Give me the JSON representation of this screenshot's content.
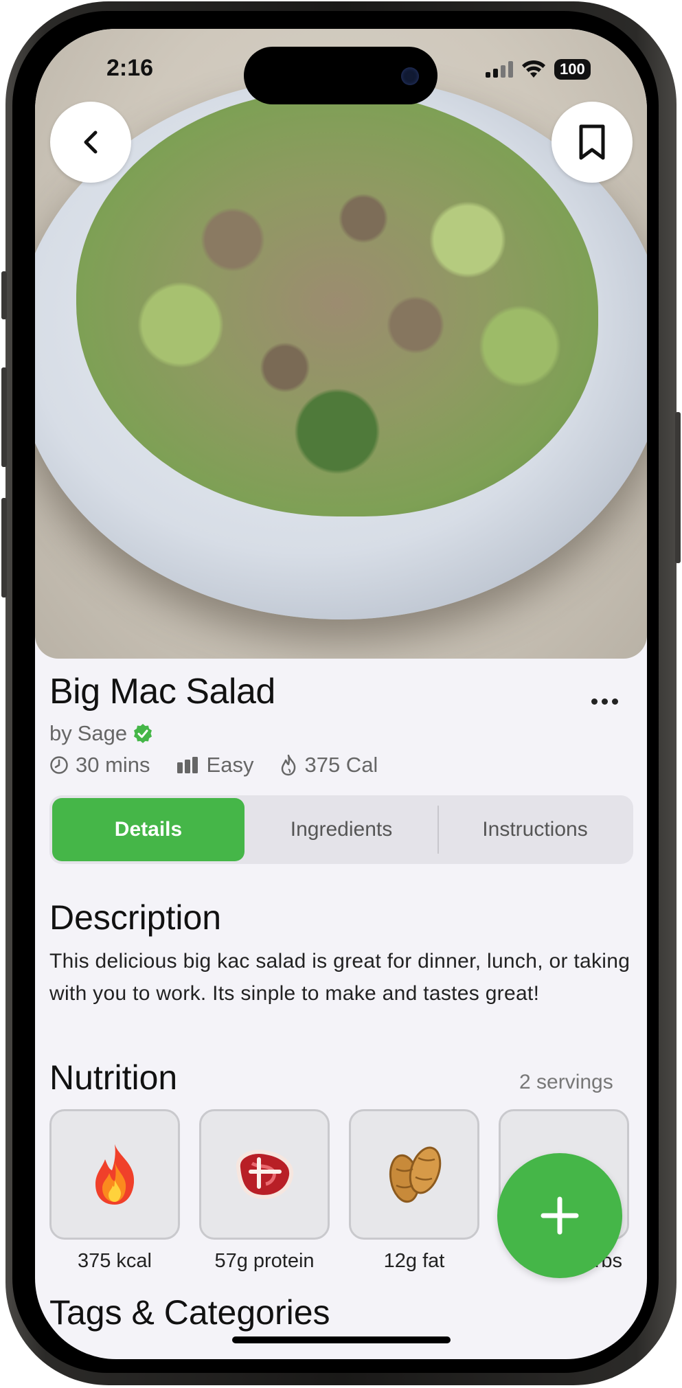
{
  "status_bar": {
    "time": "2:16",
    "battery": "100"
  },
  "hero": {
    "image_desc_icon": "salad-photo",
    "back_icon": "chevron-left-icon",
    "bookmark_icon": "bookmark-icon"
  },
  "recipe": {
    "title": "Big Mac Salad",
    "author_prefix": "by",
    "author": "Sage",
    "time": "30 mins",
    "difficulty": "Easy",
    "calories": "375 Cal"
  },
  "tabs": [
    {
      "label": "Details",
      "active": true
    },
    {
      "label": "Ingredients",
      "active": false
    },
    {
      "label": "Instructions",
      "active": false
    }
  ],
  "description": {
    "heading": "Description",
    "text": "This delicious big kac salad is great for dinner, lunch, or taking with you to work. Its sinple to make and tastes great!"
  },
  "nutrition": {
    "heading": "Nutrition",
    "servings": "2 servings",
    "items": [
      {
        "icon": "fire-emoji",
        "label": "375 kcal"
      },
      {
        "icon": "steak-emoji",
        "label": "57g protein"
      },
      {
        "icon": "peanut-emoji",
        "label": "12g fat"
      },
      {
        "icon": "rice-emoji",
        "label": "carbs"
      }
    ]
  },
  "tags": {
    "heading": "Tags & Categories"
  },
  "colors": {
    "accent": "#45b648",
    "background": "#f4f3f8",
    "verified": "#45b648"
  }
}
